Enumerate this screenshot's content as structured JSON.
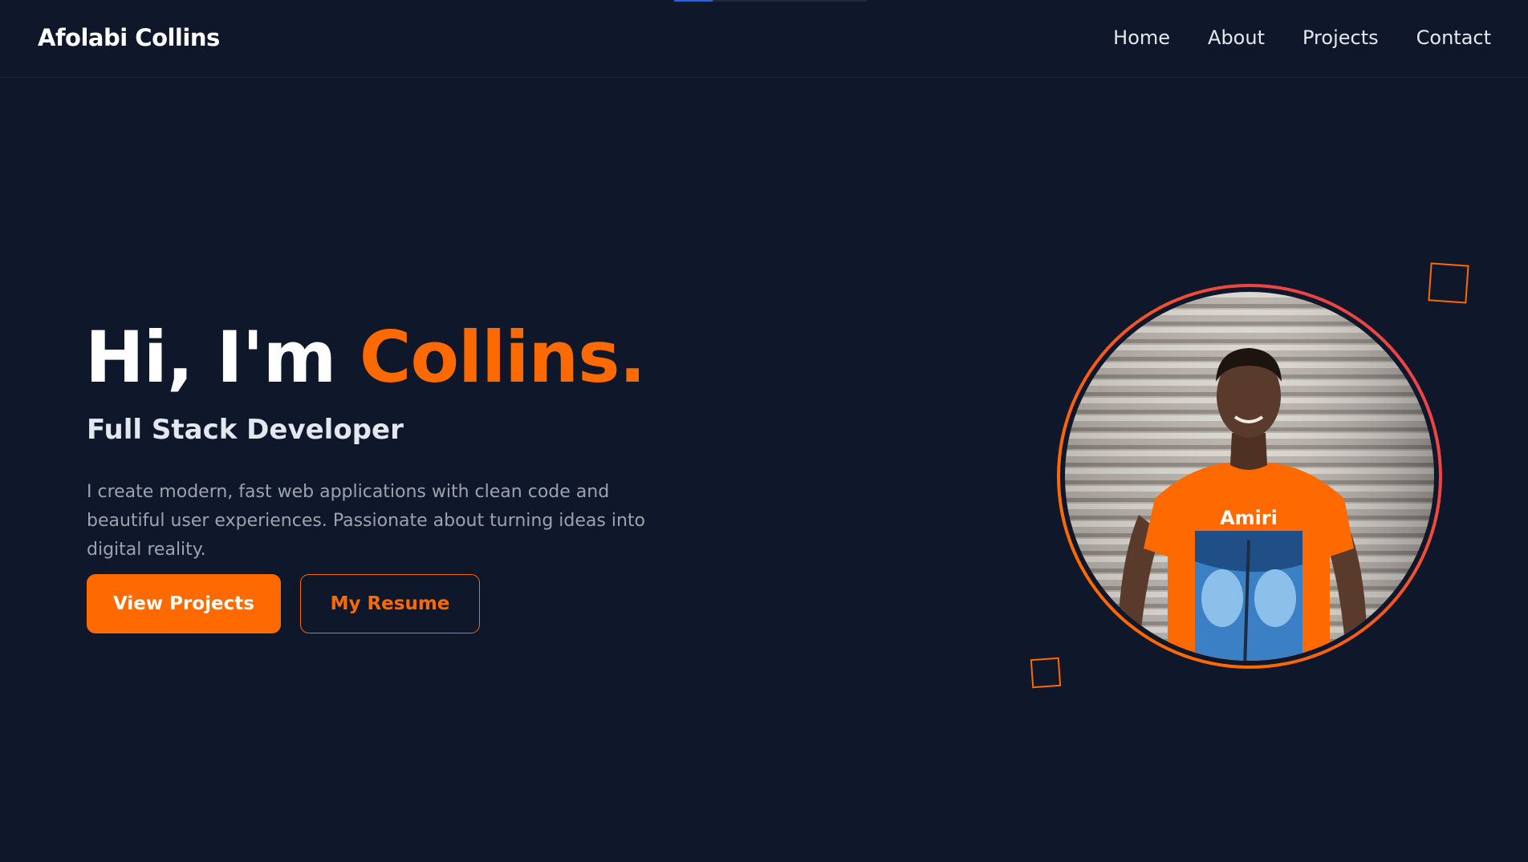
{
  "header": {
    "brand": "Afolabi Collins",
    "nav": [
      "Home",
      "About",
      "Projects",
      "Contact"
    ]
  },
  "loading_progress": 0.2,
  "hero": {
    "greeting": "Hi, I'm",
    "name": "Collins.",
    "subtitle": "Full Stack Developer",
    "description": "I create modern, fast web applications with clean code and beautiful user experiences. Passionate about turning ideas into digital reality.",
    "primary_button": "View Projects",
    "secondary_button": "My Resume",
    "photo_shirt_text": "Amiri"
  },
  "colors": {
    "background": "#0f172a",
    "accent": "#ff6a00",
    "ring_secondary": "#ef4444",
    "text_muted": "#9ca3af"
  }
}
